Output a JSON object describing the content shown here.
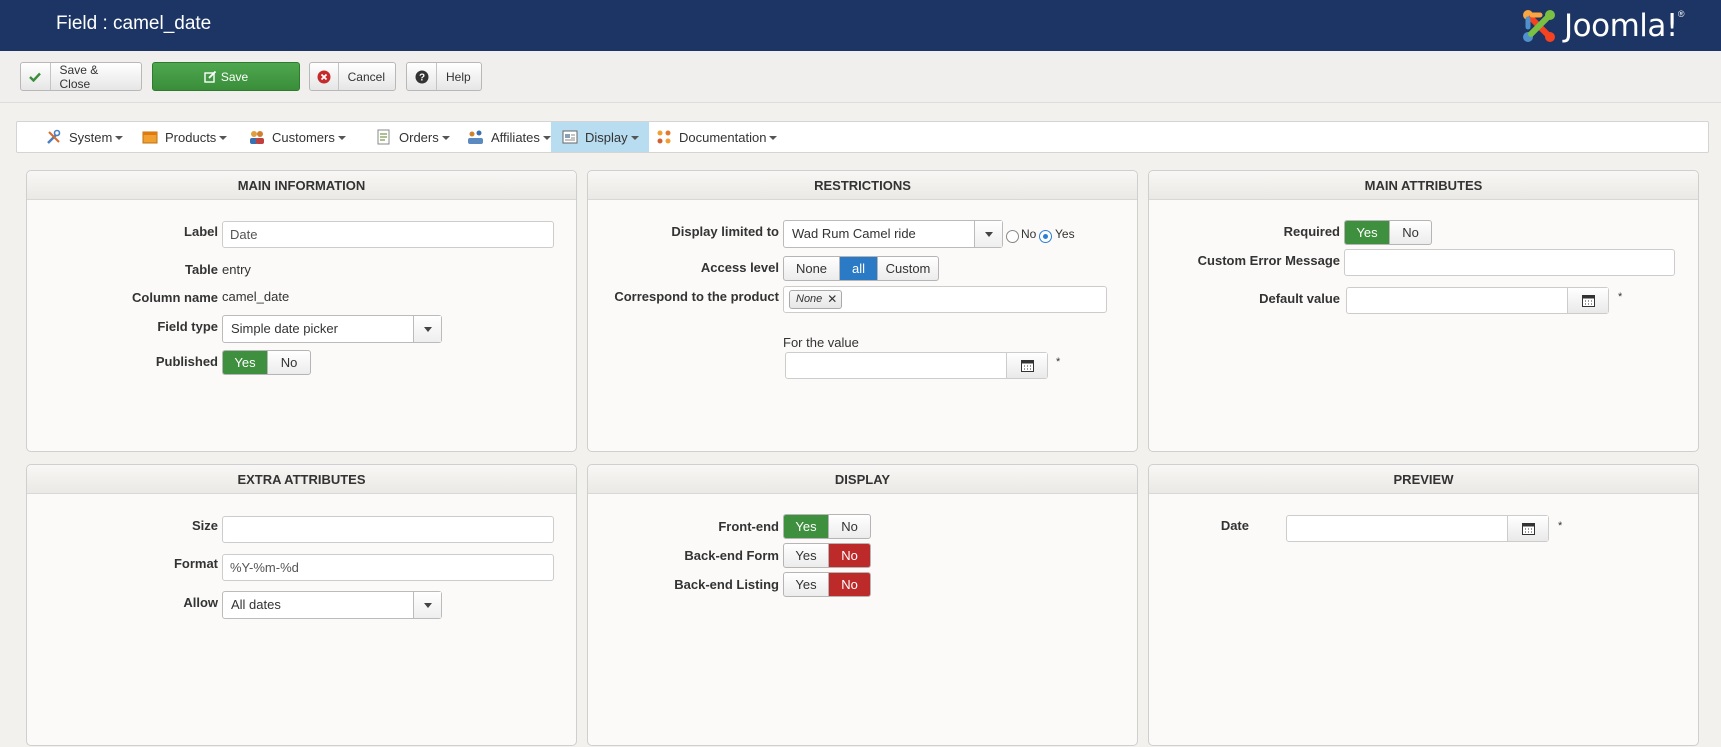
{
  "header": {
    "title": "Field : camel_date",
    "logo_text": "Joomla!",
    "logo_reg": "®"
  },
  "toolbar": {
    "save_close": "Save & Close",
    "save": "Save",
    "cancel": "Cancel",
    "help": "Help"
  },
  "menu": [
    {
      "label": "System",
      "icon": "tools-icon"
    },
    {
      "label": "Products",
      "icon": "box-icon"
    },
    {
      "label": "Customers",
      "icon": "users-icon"
    },
    {
      "label": "Orders",
      "icon": "orders-icon"
    },
    {
      "label": "Affiliates",
      "icon": "affiliates-icon"
    },
    {
      "label": "Display",
      "icon": "display-icon",
      "active": true
    },
    {
      "label": "Documentation",
      "icon": "documentation-icon"
    }
  ],
  "main_information": {
    "title": "MAIN INFORMATION",
    "label_label": "Label",
    "label_value": "Date",
    "table_label": "Table",
    "table_value": "entry",
    "column_label": "Column name",
    "column_value": "camel_date",
    "fieldtype_label": "Field type",
    "fieldtype_value": "Simple date picker",
    "published_label": "Published",
    "published_yes": "Yes",
    "published_no": "No",
    "published_value": "Yes"
  },
  "restrictions": {
    "title": "RESTRICTIONS",
    "display_limited_label": "Display limited to",
    "display_limited_value": "Wad Rum Camel ride",
    "radio_no": "No",
    "radio_yes": "Yes",
    "radio_value": "Yes",
    "access_label": "Access level",
    "access_options": [
      "None",
      "all",
      "Custom"
    ],
    "access_value": "all",
    "correspond_label": "Correspond to the product",
    "correspond_tag": "None",
    "for_value_label": "For the value",
    "for_value": "",
    "required_mark": "*"
  },
  "main_attributes": {
    "title": "MAIN ATTRIBUTES",
    "required_label": "Required",
    "required_yes": "Yes",
    "required_no": "No",
    "required_value": "Yes",
    "error_label": "Custom Error Message",
    "error_value": "",
    "default_label": "Default value",
    "default_value": "",
    "required_mark": "*"
  },
  "extra_attributes": {
    "title": "EXTRA ATTRIBUTES",
    "size_label": "Size",
    "size_value": "",
    "format_label": "Format",
    "format_value": "%Y-%m-%d",
    "allow_label": "Allow",
    "allow_value": "All dates"
  },
  "display": {
    "title": "DISPLAY",
    "frontend_label": "Front-end",
    "frontend_value": "Yes",
    "backend_form_label": "Back-end Form",
    "backend_form_value": "No",
    "backend_listing_label": "Back-end Listing",
    "backend_listing_value": "No",
    "yes": "Yes",
    "no": "No"
  },
  "preview": {
    "title": "PREVIEW",
    "date_label": "Date",
    "date_value": "",
    "required_mark": "*"
  }
}
